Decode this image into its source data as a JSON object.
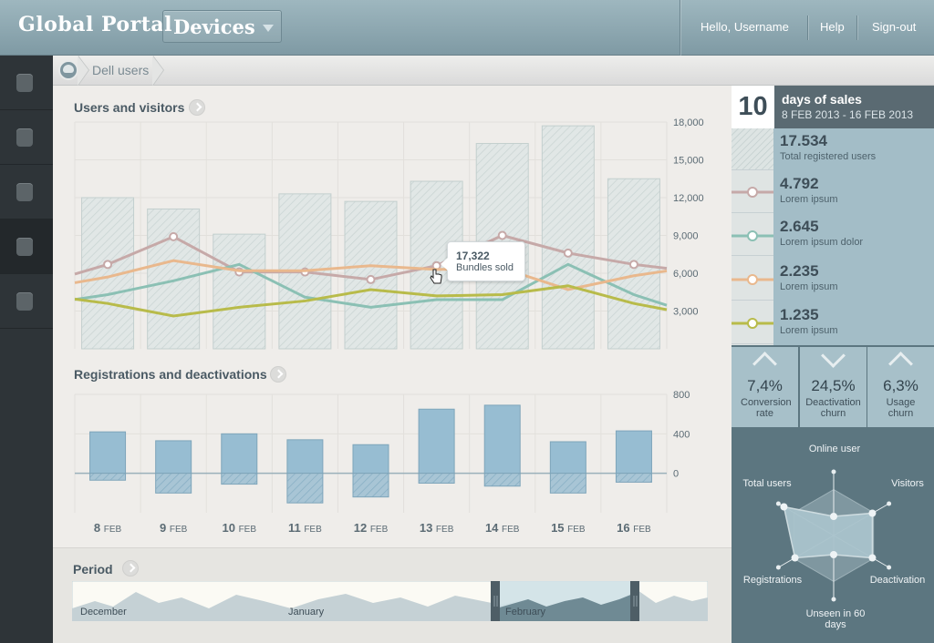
{
  "header": {
    "logo": "Global Portal",
    "section": "Devices",
    "greeting": "Hello, Username",
    "help": "Help",
    "signout": "Sign-out"
  },
  "sidebar": {
    "items": [
      "nav-1",
      "nav-2",
      "nav-3",
      "nav-4",
      "nav-5"
    ],
    "active_index": 3
  },
  "breadcrumb": {
    "current": "Dell users"
  },
  "panels": {
    "users_title": "Users and visitors",
    "registrations_title": "Registrations and deactivations",
    "period_title": "Period"
  },
  "tooltip": {
    "value": "17,322",
    "label": "Bundles sold"
  },
  "chart_data": [
    {
      "type": "bar",
      "title": "Users and visitors",
      "categories": [
        "8 FEB",
        "9 FEB",
        "10 FEB",
        "11 FEB",
        "12 FEB",
        "13 FEB",
        "14 FEB",
        "15 FEB",
        "16 FEB"
      ],
      "ylim": [
        0,
        18000
      ],
      "yticks": [
        "18,000",
        "15,000",
        "12,000",
        "9,000",
        "6,000",
        "3,000"
      ],
      "ytick_values": [
        18000,
        15000,
        12000,
        9000,
        6000,
        3000
      ],
      "series": [
        {
          "name": "Total registered users",
          "kind": "bar",
          "color": "#d7e0df",
          "values": [
            12000,
            11100,
            9100,
            12300,
            11700,
            13300,
            16300,
            17700,
            13500
          ]
        },
        {
          "name": "Lorem ipsum",
          "kind": "line",
          "color": "#c6a9a8",
          "markers": true,
          "values": [
            6700,
            8900,
            6100,
            6100,
            5500,
            6600,
            9000,
            7600,
            6700
          ]
        },
        {
          "name": "Lorem ipsum dolor",
          "kind": "line",
          "color": "#8bc0b4",
          "values": [
            4300,
            5400,
            6700,
            4100,
            3300,
            3900,
            3900,
            6700,
            4300
          ]
        },
        {
          "name": "Lorem ipsum",
          "kind": "line",
          "color": "#e9b88d",
          "values": [
            5700,
            7000,
            6200,
            6200,
            6600,
            6300,
            6400,
            4700,
            5800
          ]
        },
        {
          "name": "Lorem ipsum",
          "kind": "line",
          "color": "#b8bb4a",
          "values": [
            3600,
            2600,
            3300,
            3800,
            4700,
            4200,
            4300,
            5000,
            3600
          ]
        }
      ]
    },
    {
      "type": "bar",
      "title": "Registrations and deactivations",
      "categories": [
        "8 FEB",
        "9 FEB",
        "10 FEB",
        "11 FEB",
        "12 FEB",
        "13 FEB",
        "14 FEB",
        "15 FEB",
        "16 FEB"
      ],
      "ylim": [
        -400,
        800
      ],
      "yticks": [
        "800",
        "400",
        "0"
      ],
      "ytick_values": [
        800,
        400,
        0
      ],
      "series": [
        {
          "name": "Registrations",
          "color": "#93b8cc",
          "values": [
            420,
            330,
            400,
            340,
            290,
            650,
            690,
            320,
            430
          ]
        },
        {
          "name": "Deactivations",
          "color": "#93b8cc",
          "values": [
            -70,
            -200,
            -110,
            -300,
            -240,
            -100,
            -130,
            -200,
            -90
          ]
        }
      ]
    }
  ],
  "dates": [
    {
      "day": "8",
      "mon": "FEB"
    },
    {
      "day": "9",
      "mon": "FEB"
    },
    {
      "day": "10",
      "mon": "FEB"
    },
    {
      "day": "11",
      "mon": "FEB"
    },
    {
      "day": "12",
      "mon": "FEB"
    },
    {
      "day": "13",
      "mon": "FEB"
    },
    {
      "day": "14",
      "mon": "FEB"
    },
    {
      "day": "15",
      "mon": "FEB"
    },
    {
      "day": "16",
      "mon": "FEB"
    }
  ],
  "period": {
    "months": [
      "December",
      "January",
      "February"
    ],
    "selected": "February"
  },
  "summary": {
    "days": "10",
    "days_label": "days of sales",
    "range": "8 FEB 2013 - 16 FEB 2013",
    "legend": [
      {
        "value": "17.534",
        "label": "Total registered users",
        "color": "#d7e0df",
        "swatch": "hatch"
      },
      {
        "value": "4.792",
        "label": "Lorem ipsum",
        "color": "#c6a9a8",
        "swatch": "line"
      },
      {
        "value": "2.645",
        "label": "Lorem ipsum dolor",
        "color": "#8bc0b4",
        "swatch": "line"
      },
      {
        "value": "2.235",
        "label": "Lorem ipsum",
        "color": "#e9b88d",
        "swatch": "line"
      },
      {
        "value": "1.235",
        "label": "Lorem ipsum",
        "color": "#b8bb4a",
        "swatch": "line"
      }
    ],
    "stats": [
      {
        "value": "7,4%",
        "label": "Conversion rate",
        "direction": "up",
        "icon": "chevron-up-icon"
      },
      {
        "value": "24,5%",
        "label": "Deactivation churn",
        "direction": "down",
        "icon": "chevron-down-icon"
      },
      {
        "value": "6,3%",
        "label": "Usage churn",
        "direction": "up",
        "icon": "chevron-up-icon"
      }
    ],
    "radar": {
      "axes": [
        "Online user",
        "Visitors",
        "Deactivation",
        "Unseen in 60 days",
        "Registrations",
        "Total users"
      ],
      "values": [
        0.3,
        0.7,
        0.7,
        0.3,
        0.7,
        0.9
      ]
    }
  }
}
